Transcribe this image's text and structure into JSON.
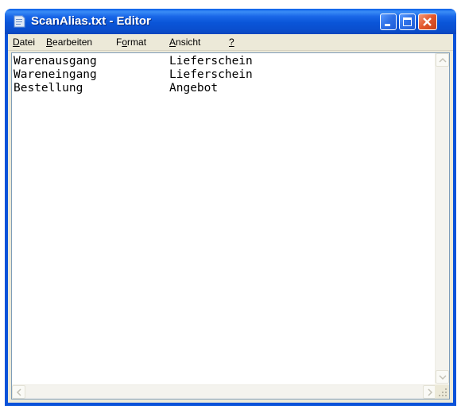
{
  "window": {
    "title": "ScanAlias.txt - Editor",
    "icons": {
      "app": "notepad-icon",
      "minimize": "minimize-icon",
      "maximize": "maximize-icon",
      "close": "close-icon"
    },
    "colors": {
      "titlebar": "#0a55d8",
      "close": "#e2562b",
      "frame": "#0a52d9"
    }
  },
  "menu": {
    "file": {
      "pre": "",
      "accel": "D",
      "post": "atei"
    },
    "edit": {
      "pre": "",
      "accel": "B",
      "post": "earbeiten"
    },
    "format": {
      "pre": "F",
      "accel": "o",
      "post": "rmat"
    },
    "view": {
      "pre": "",
      "accel": "A",
      "post": "nsicht"
    },
    "help": {
      "pre": "",
      "accel": "?",
      "post": ""
    }
  },
  "document": {
    "lines": [
      {
        "left": "Warenausgang",
        "right": "Lieferschein"
      },
      {
        "left": "Wareneingang",
        "right": "Lieferschein"
      },
      {
        "left": "Bestellung",
        "right": "Angebot"
      }
    ]
  }
}
